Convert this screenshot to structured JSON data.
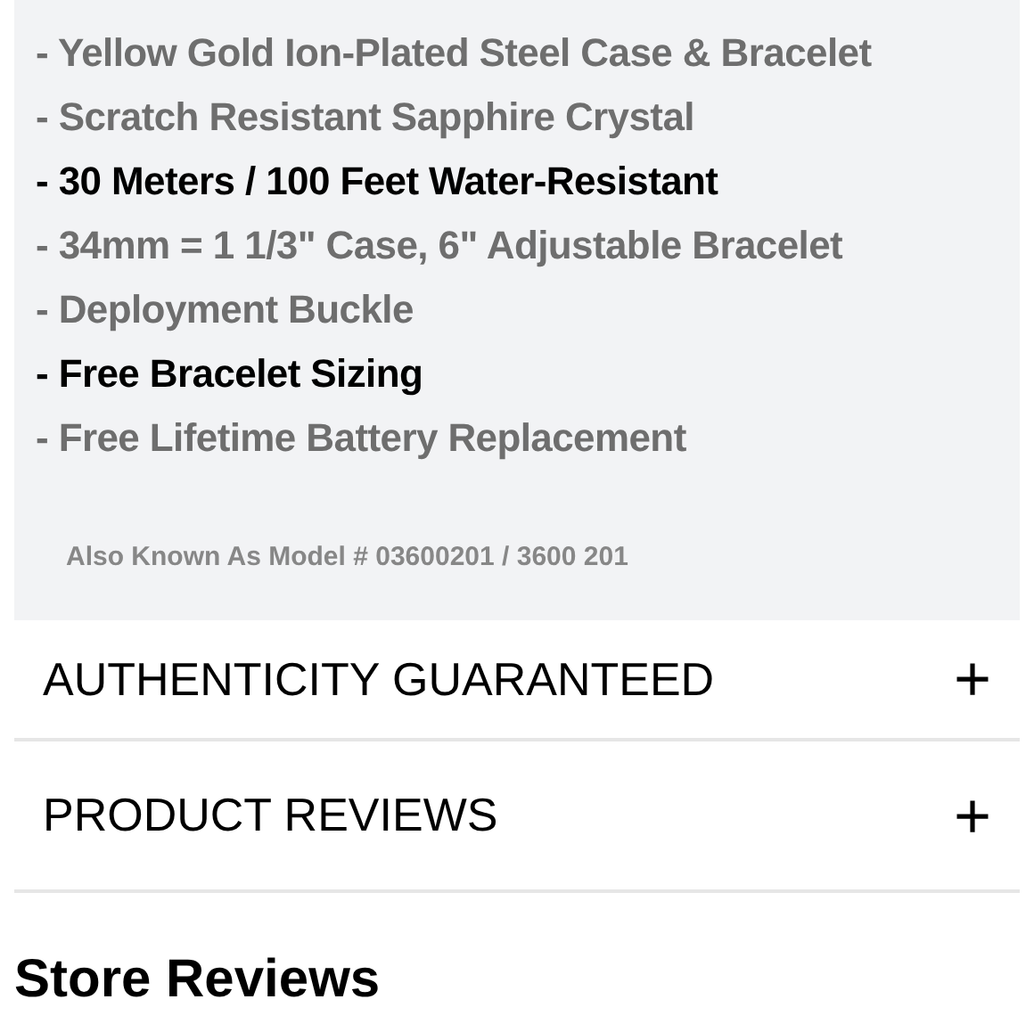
{
  "features": [
    {
      "text": "- Yellow Gold Ion-Plated Steel Case & Bracelet",
      "emphasized": false
    },
    {
      "text": "- Scratch Resistant Sapphire Crystal",
      "emphasized": false
    },
    {
      "text": "- 30 Meters / 100 Feet Water-Resistant",
      "emphasized": true
    },
    {
      "text": "- 34mm = 1 1/3\" Case, 6\" Adjustable Bracelet",
      "emphasized": false
    },
    {
      "text": "- Deployment Buckle",
      "emphasized": false
    },
    {
      "text": "- Free Bracelet Sizing",
      "emphasized": true
    },
    {
      "text": "- Free Lifetime Battery Replacement",
      "emphasized": false
    }
  ],
  "model_note": "Also Known As Model # 03600201 / 3600 201",
  "accordion": [
    {
      "title": "AUTHENTICITY GUARANTEED",
      "icon": "+"
    },
    {
      "title": "PRODUCT REVIEWS",
      "icon": "+"
    }
  ],
  "section_heading": "Store Reviews"
}
